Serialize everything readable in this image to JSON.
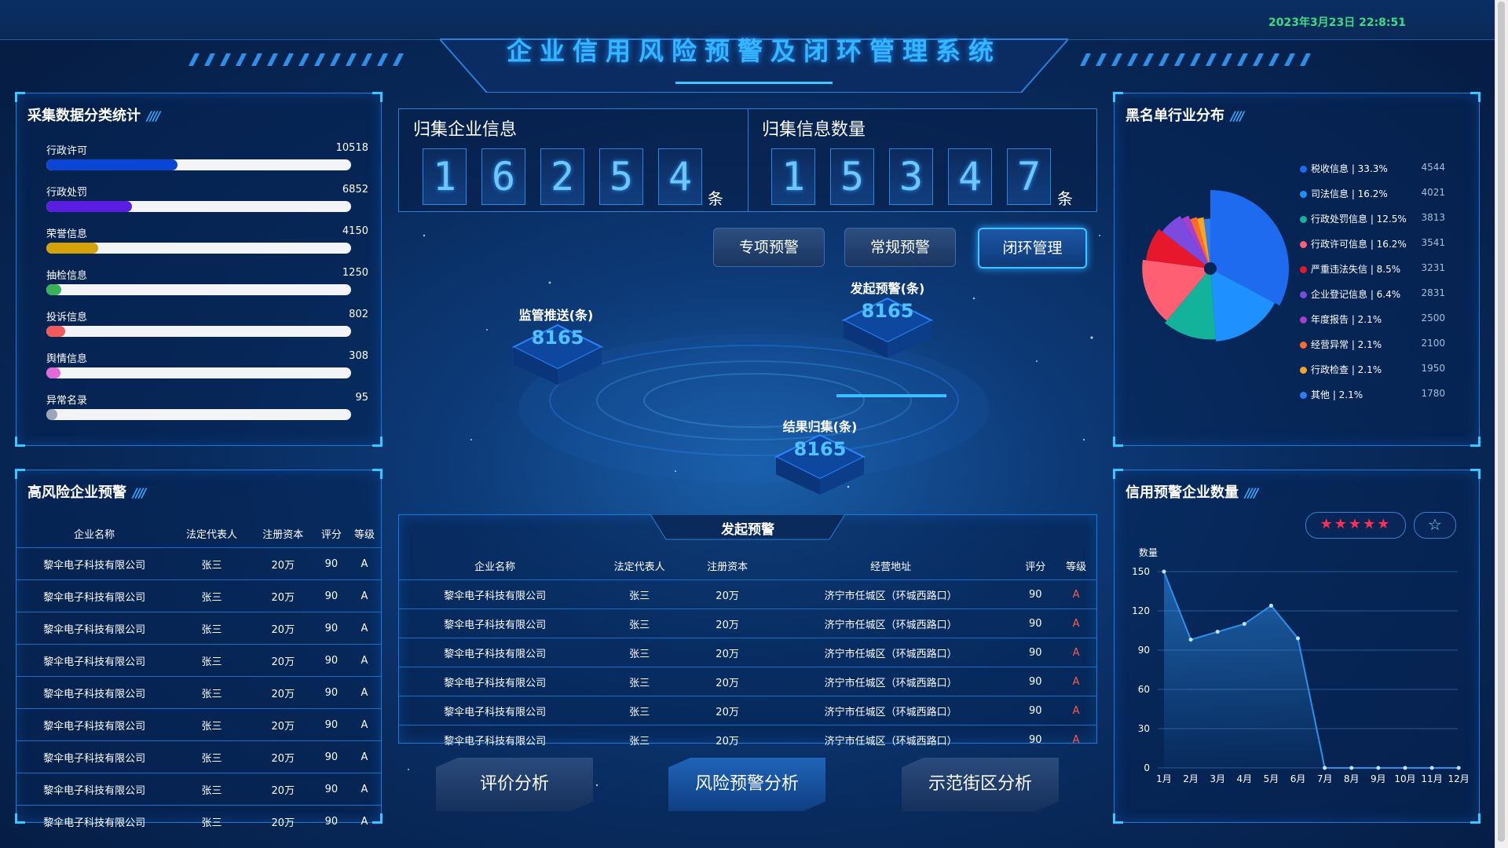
{
  "header": {
    "title": "企业信用风险预警及闭环管理系统",
    "datetime": "2023年3月23日 22:8:51"
  },
  "collection_stats": {
    "title": "采集数据分类统计",
    "items": [
      {
        "label": "行政许可",
        "value": "10518",
        "fraction": 0.43,
        "color": "#0a46d6"
      },
      {
        "label": "行政处罚",
        "value": "6852",
        "fraction": 0.28,
        "color": "#5a1ee0"
      },
      {
        "label": "荣誉信息",
        "value": "4150",
        "fraction": 0.17,
        "color": "#d4a30a"
      },
      {
        "label": "抽检信息",
        "value": "1250",
        "fraction": 0.05,
        "color": "#38b35a"
      },
      {
        "label": "投诉信息",
        "value": "802",
        "fraction": 0.03,
        "color": "#f05a5a"
      },
      {
        "label": "舆情信息",
        "value": "308",
        "fraction": 0.015,
        "color": "#e26ad8"
      },
      {
        "label": "异常名录",
        "value": "95",
        "fraction": 0.004,
        "color": "#9aa6b8"
      }
    ]
  },
  "high_risk": {
    "title": "高风险企业预警",
    "columns": [
      "企业名称",
      "法定代表人",
      "注册资本",
      "评分",
      "等级"
    ],
    "rows": [
      [
        "黎伞电子科技有限公司",
        "张三",
        "20万",
        "90",
        "A"
      ],
      [
        "黎伞电子科技有限公司",
        "张三",
        "20万",
        "90",
        "A"
      ],
      [
        "黎伞电子科技有限公司",
        "张三",
        "20万",
        "90",
        "A"
      ],
      [
        "黎伞电子科技有限公司",
        "张三",
        "20万",
        "90",
        "A"
      ],
      [
        "黎伞电子科技有限公司",
        "张三",
        "20万",
        "90",
        "A"
      ],
      [
        "黎伞电子科技有限公司",
        "张三",
        "20万",
        "90",
        "A"
      ],
      [
        "黎伞电子科技有限公司",
        "张三",
        "20万",
        "90",
        "A"
      ],
      [
        "黎伞电子科技有限公司",
        "张三",
        "20万",
        "90",
        "A"
      ],
      [
        "黎伞电子科技有限公司",
        "张三",
        "20万",
        "90",
        "A"
      ]
    ]
  },
  "counters": {
    "enterprise": {
      "label": "归集企业信息",
      "digits": [
        "1",
        "6",
        "2",
        "5",
        "4"
      ],
      "unit": "条"
    },
    "info": {
      "label": "归集信息数量",
      "digits": [
        "1",
        "5",
        "3",
        "4",
        "7"
      ],
      "unit": "条"
    }
  },
  "buttons": {
    "special": "专项预警",
    "regular": "常规预警",
    "closed_loop": "闭环管理"
  },
  "stages": {
    "supervision": {
      "label": "监管推送(条)",
      "value": "8165"
    },
    "initiate": {
      "label": "发起预警(条)",
      "value": "8165"
    },
    "result": {
      "label": "结果归集(条)",
      "value": "8165"
    }
  },
  "warning_table": {
    "title": "发起预警",
    "columns": [
      "企业名称",
      "法定代表人",
      "注册资本",
      "经营地址",
      "评分",
      "等级"
    ],
    "rows": [
      [
        "黎伞电子科技有限公司",
        "张三",
        "20万",
        "济宁市任城区（环城西路口）",
        "90",
        "A"
      ],
      [
        "黎伞电子科技有限公司",
        "张三",
        "20万",
        "济宁市任城区（环城西路口）",
        "90",
        "A"
      ],
      [
        "黎伞电子科技有限公司",
        "张三",
        "20万",
        "济宁市任城区（环城西路口）",
        "90",
        "A"
      ],
      [
        "黎伞电子科技有限公司",
        "张三",
        "20万",
        "济宁市任城区（环城西路口）",
        "90",
        "A"
      ],
      [
        "黎伞电子科技有限公司",
        "张三",
        "20万",
        "济宁市任城区（环城西路口）",
        "90",
        "A"
      ],
      [
        "黎伞电子科技有限公司",
        "张三",
        "20万",
        "济宁市任城区（环城西路口）",
        "90",
        "A"
      ]
    ]
  },
  "bottom_nav": {
    "evaluation": "评价分析",
    "risk": "风险预警分析",
    "demo": "示范街区分析"
  },
  "blacklist": {
    "title": "黑名单行业分布",
    "chart_data": {
      "type": "pie",
      "slices": [
        {
          "label": "税收信息 | 33.3%",
          "value": 4544,
          "percent": 33.3,
          "color": "#1e6bf0"
        },
        {
          "label": "司法信息 | 16.2%",
          "value": 4021,
          "percent": 16.2,
          "color": "#1e90ff"
        },
        {
          "label": "行政处罚信息 | 12.5%",
          "value": 3813,
          "percent": 12.5,
          "color": "#12b39a"
        },
        {
          "label": "行政许可信息 | 16.2%",
          "value": 3541,
          "percent": 16.2,
          "color": "#ff5f73"
        },
        {
          "label": "严重违法失信 | 8.5%",
          "value": 3231,
          "percent": 8.5,
          "color": "#e8182c"
        },
        {
          "label": "企业登记信息 | 6.4%",
          "value": 2831,
          "percent": 6.4,
          "color": "#7b4be0"
        },
        {
          "label": "年度报告 | 2.1%",
          "value": 2500,
          "percent": 2.1,
          "color": "#a43fd0"
        },
        {
          "label": "经营异常 | 2.1%",
          "value": 2100,
          "percent": 2.1,
          "color": "#ff6a2a"
        },
        {
          "label": "行政检查 | 2.1%",
          "value": 1950,
          "percent": 2.1,
          "color": "#f5a623"
        },
        {
          "label": "其他 | 2.1%",
          "value": 1780,
          "percent": 2.1,
          "color": "#2f7bf0"
        }
      ]
    }
  },
  "credit_warning": {
    "title": "信用预警企业数量",
    "stars": "★★★★★",
    "star_button": "☆",
    "chart_data": {
      "type": "area",
      "ylabel": "数量",
      "categories": [
        "1月",
        "2月",
        "3月",
        "4月",
        "5月",
        "6月",
        "7月",
        "8月",
        "9月",
        "10月",
        "11月",
        "12月"
      ],
      "values": [
        150,
        98,
        104,
        110,
        124,
        99,
        0,
        0,
        0,
        0,
        0,
        0
      ],
      "yticks": [
        "0",
        "30",
        "60",
        "90",
        "120",
        "150"
      ],
      "ylim": [
        0,
        150
      ],
      "color": "#2f8fe8"
    }
  }
}
